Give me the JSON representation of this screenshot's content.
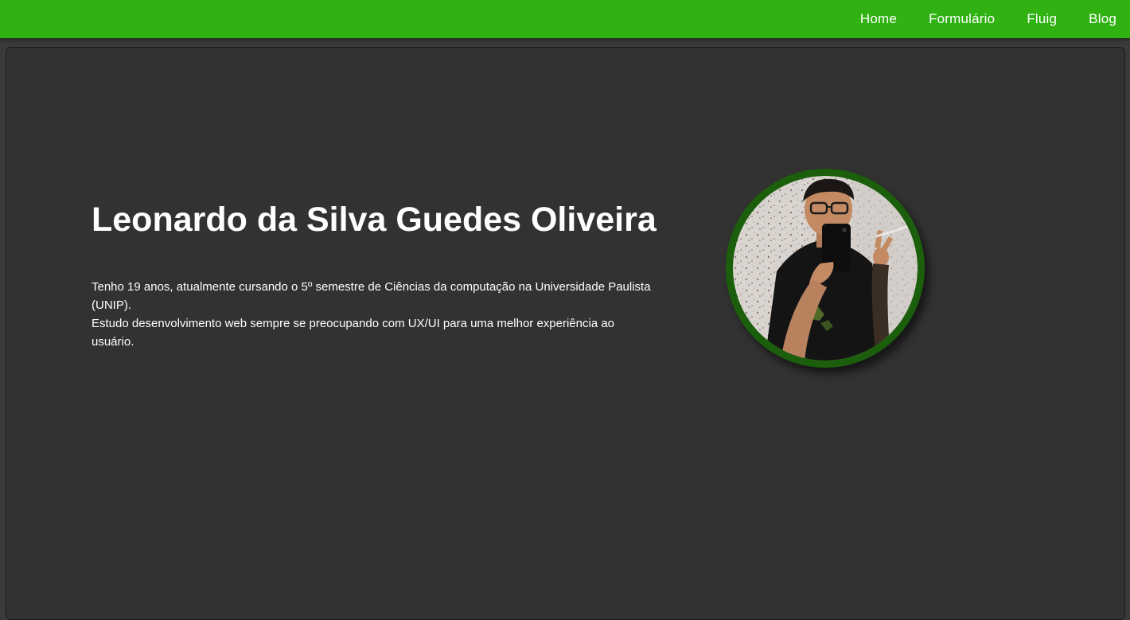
{
  "nav": {
    "items": [
      {
        "label": "Home"
      },
      {
        "label": "Formulário"
      },
      {
        "label": "Fluig"
      },
      {
        "label": "Blog"
      }
    ]
  },
  "profile": {
    "name": "Leonardo da Silva Guedes Oliveira",
    "bio_line1": "Tenho 19 anos, atualmente cursando o 5º semestre de Ciências da computação na Universidade Paulista (UNIP).",
    "bio_line2": "Estudo desenvolvimento web sempre se preocupando com UX/UI para uma melhor experiência ao usuário."
  },
  "colors": {
    "navbar": "#2fb212",
    "card_background": "#323232",
    "avatar_ring": "#1b5e0c"
  }
}
